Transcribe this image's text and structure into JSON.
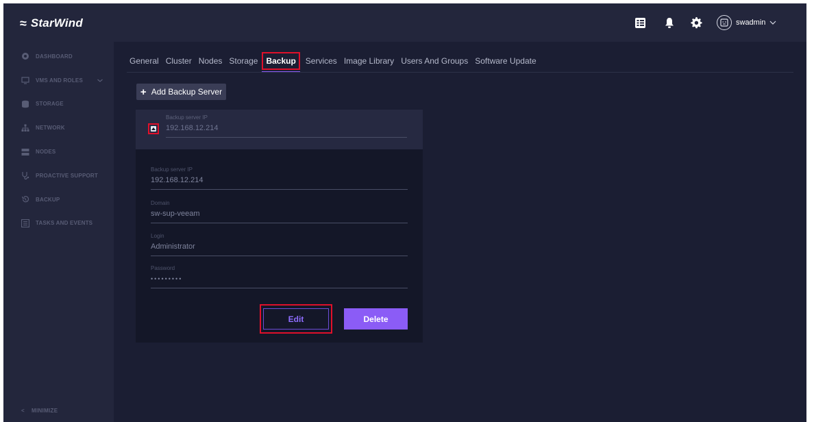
{
  "app": {
    "logo_text": "StarWind"
  },
  "sidebar": {
    "items": [
      {
        "label": "DASHBOARD",
        "icon": "dashboard-icon"
      },
      {
        "label": "VMS AND ROLES",
        "icon": "vms-icon",
        "has_chevron": true
      },
      {
        "label": "STORAGE",
        "icon": "storage-icon"
      },
      {
        "label": "NETWORK",
        "icon": "network-icon"
      },
      {
        "label": "NODES",
        "icon": "nodes-icon"
      },
      {
        "label": "PROACTIVE SUPPORT",
        "icon": "stethoscope-icon"
      },
      {
        "label": "BACKUP",
        "icon": "backup-icon"
      },
      {
        "label": "TASKS AND EVENTS",
        "icon": "tasks-icon"
      }
    ],
    "minimize_label": "MINIMIZE"
  },
  "topbar": {
    "icons": [
      "task-list-icon",
      "bell-icon",
      "gear-icon"
    ],
    "username": "swadmin"
  },
  "tabs": [
    {
      "label": "General",
      "active": false
    },
    {
      "label": "Cluster",
      "active": false
    },
    {
      "label": "Nodes",
      "active": false
    },
    {
      "label": "Storage",
      "active": false
    },
    {
      "label": "Backup",
      "active": true
    },
    {
      "label": "Services",
      "active": false
    },
    {
      "label": "Image Library",
      "active": false
    },
    {
      "label": "Users And Groups",
      "active": false
    },
    {
      "label": "Software Update",
      "active": false
    }
  ],
  "add_button_label": "Add Backup Server",
  "server": {
    "header": {
      "label": "Backup server IP",
      "value": "192.168.12.214"
    },
    "fields": [
      {
        "label": "Backup server IP",
        "value": "192.168.12.214"
      },
      {
        "label": "Domain",
        "value": "sw-sup-veeam"
      },
      {
        "label": "Login",
        "value": "Administrator"
      },
      {
        "label": "Password",
        "value": "•••••••••"
      }
    ],
    "edit_label": "Edit",
    "delete_label": "Delete"
  },
  "colors": {
    "accent": "#8b5cf6",
    "highlight_border": "#e0102a",
    "background": "#1b1e33",
    "sidebar": "#23263c"
  }
}
